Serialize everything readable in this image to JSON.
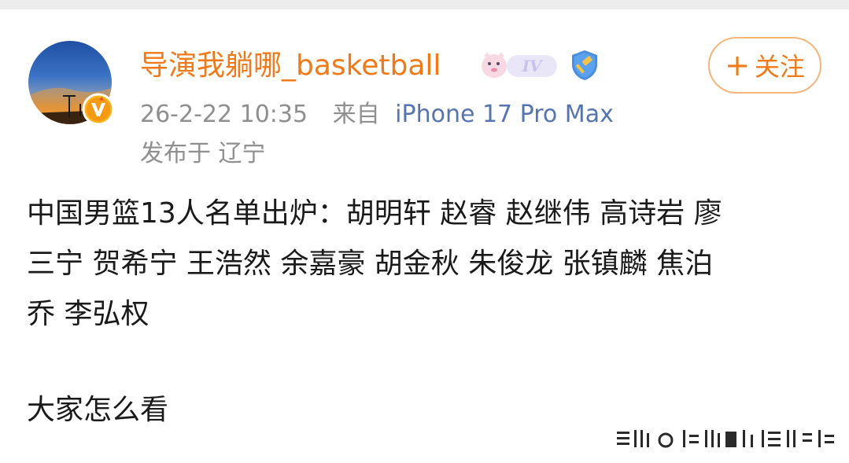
{
  "post": {
    "username": "导演我躺哪_basketball",
    "level_badge": "IV",
    "timestamp": "26-2-22 10:35",
    "from_label": "来自",
    "device": "iPhone 17 Pro Max",
    "location_prefix": "发布于",
    "location": "辽宁",
    "follow_label": "关注",
    "content_lines": [
      "中国男篮13人名单出炉：胡明轩 赵睿 赵继伟 高诗岩 廖",
      "三宁 贺希宁 王浩然 余嘉豪 胡金秋 朱俊龙  张镇麟 焦泊",
      "乔 李弘权"
    ],
    "question": "大家怎么看"
  },
  "colors": {
    "accent": "#f07a1a",
    "follow_border": "#f5b47a",
    "meta_gray": "#8f8f8f",
    "device_blue": "#5575b0",
    "verify_blue": "#4a8ee0",
    "body_text": "#1a1a1a"
  },
  "icons": {
    "avatar": "sunset-streetlight-avatar",
    "v_badge": "orange-v-verified-icon",
    "level": "cartoon-level-iv-badge-icon",
    "verify": "blue-shield-hammer-icon",
    "plus": "plus-icon"
  }
}
